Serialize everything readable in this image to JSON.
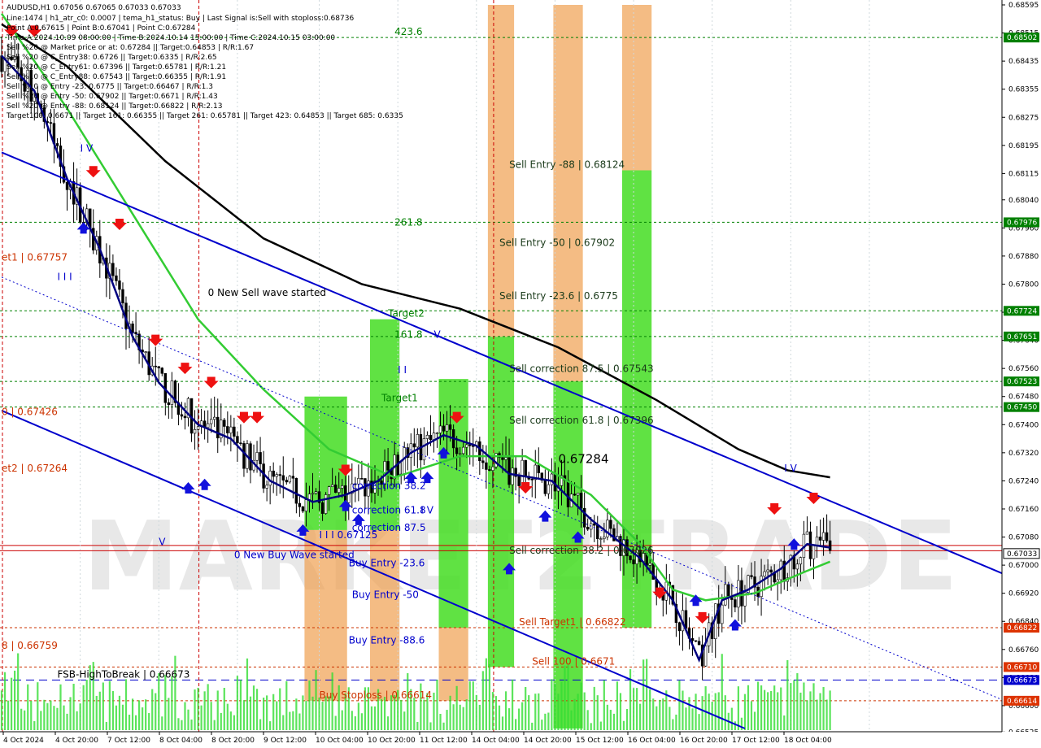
{
  "header": {
    "symbol_line": "AUDUSD,H1  0.67056 0.67065 0.67033 0.67033",
    "info_lines": [
      "Line:1474 | h1_atr_c0: 0.0007 | tema_h1_status: Buy | Last Signal is:Sell with stoploss:0.68736",
      "Point A:0.67615 | Point B:0.67041 | Point C:0.67284",
      "Time A:2024.10.09 08:00:00 | Time B:2024.10.14 15:00:00 | Time C:2024.10.15 03:00:00",
      "Sell %20 @ Market price or at: 0.67284 || Target:0.64853 | R/R:1.67",
      "Sell %20 @ C_Entry38: 0.6726 || Target:0.6335 | R/R:2.65",
      "Sell %20 @ C_Entry61: 0.67396 || Target:0.65781 | R/R:1.21",
      "Sell %10 @ C_Entry88: 0.67543 || Target:0.66355 | R/R:1.91",
      "Sell %10 @ Entry -23: 0.6775 || Target:0.66467 | R/R:1.3",
      "Sell %20 @ Entry -50: 0.67902 || Target:0.6671 | R/R:1.43",
      "Sell %20 @ Entry -88: 0.68124 || Target:0.66822 | R/R:2.13",
      "Target100: 0.6671 || Target 161: 0.66355 || Target 261: 0.65781 || Target 423: 0.64853 || Target 685: 0.6335"
    ]
  },
  "watermark": "MARKET2TRADE",
  "colors": {
    "background": "#ffffff",
    "ema_black": "#000000",
    "tema_navy": "#000080",
    "ema_green": "#33cc33",
    "channel_blue": "#0000cc",
    "level_green": "#008000",
    "level_red": "#cc3300",
    "fsb_blue": "#0000cc",
    "zone_orange": "#f0a050",
    "zone_green": "#44dd22",
    "bar_green": "#33dd33",
    "current_price": "#cc0000"
  },
  "price_axis": {
    "min": 0.66535,
    "max": 0.68595,
    "ticks": [
      "0.68595",
      "0.68515",
      "0.68435",
      "0.68355",
      "0.68275",
      "0.68195",
      "0.68115",
      "0.68040",
      "0.67960",
      "0.67880",
      "0.67800",
      "0.67720",
      "0.67640",
      "0.67560",
      "0.67480",
      "0.67400",
      "0.67320",
      "0.67240",
      "0.67160",
      "0.67080",
      "0.67000",
      "0.66920",
      "0.66840",
      "0.66760",
      "0.66680",
      "0.66600",
      "0.66525"
    ]
  },
  "time_axis": {
    "labels": [
      "4 Oct 2024",
      "4 Oct 20:00",
      "7 Oct 12:00",
      "8 Oct 04:00",
      "8 Oct 20:00",
      "9 Oct 12:00",
      "10 Oct 04:00",
      "10 Oct 20:00",
      "11 Oct 12:00",
      "14 Oct 04:00",
      "14 Oct 20:00",
      "15 Oct 12:00",
      "16 Oct 04:00",
      "16 Oct 20:00",
      "17 Oct 12:00",
      "18 Oct 04:00"
    ]
  },
  "price_tags": [
    {
      "text": "0.68502",
      "value": 0.68502,
      "kind": "green"
    },
    {
      "text": "0.67976",
      "value": 0.67976,
      "kind": "green"
    },
    {
      "text": "0.67724",
      "value": 0.67724,
      "kind": "green"
    },
    {
      "text": "0.67651",
      "value": 0.67651,
      "kind": "green"
    },
    {
      "text": "0.67523",
      "value": 0.67523,
      "kind": "green"
    },
    {
      "text": "0.67450",
      "value": 0.6745,
      "kind": "green"
    },
    {
      "text": "0.67033",
      "value": 0.67033,
      "kind": "black"
    },
    {
      "text": "0.66822",
      "value": 0.66822,
      "kind": "red"
    },
    {
      "text": "0.66710",
      "value": 0.6671,
      "kind": "red"
    },
    {
      "text": "0.66673",
      "value": 0.66673,
      "kind": "blue"
    },
    {
      "text": "0.66614",
      "value": 0.66614,
      "kind": "red"
    }
  ],
  "levels": [
    {
      "value": 0.68502,
      "color": "green"
    },
    {
      "value": 0.67976,
      "color": "green"
    },
    {
      "value": 0.67724,
      "color": "green"
    },
    {
      "value": 0.67651,
      "color": "green"
    },
    {
      "value": 0.67523,
      "color": "green"
    },
    {
      "value": 0.6745,
      "color": "green"
    },
    {
      "value": 0.66822,
      "color": "red"
    },
    {
      "value": 0.6671,
      "color": "red"
    },
    {
      "value": 0.66614,
      "color": "red"
    },
    {
      "value": 0.66673,
      "color": "fsb"
    },
    {
      "value": 0.67041,
      "color": "current"
    },
    {
      "value": 0.67056,
      "color": "current"
    }
  ],
  "chart_labels": [
    {
      "text": "423.6",
      "kind": "fib",
      "x_bar": 120,
      "value": 0.68502
    },
    {
      "text": "261.8",
      "kind": "fib",
      "x_bar": 120,
      "value": 0.6796
    },
    {
      "text": "161.8",
      "kind": "fib",
      "x_bar": 120,
      "value": 0.6764
    },
    {
      "text": "Target2",
      "kind": "fib",
      "x_bar": 118,
      "value": 0.677
    },
    {
      "text": "Target1",
      "kind": "fib",
      "x_bar": 116,
      "value": 0.6746
    },
    {
      "text": "Sell Entry -88 | 0.68124",
      "kind": "dark",
      "x_bar": 155,
      "value": 0.68124
    },
    {
      "text": "Sell Entry -50 | 0.67902",
      "kind": "dark",
      "x_bar": 152,
      "value": 0.67902
    },
    {
      "text": "Sell Entry -23.6 | 0.6775",
      "kind": "dark",
      "x_bar": 152,
      "value": 0.6775
    },
    {
      "text": "Sell correction 87.5 | 0.67543",
      "kind": "dark",
      "x_bar": 155,
      "value": 0.67543
    },
    {
      "text": "Sell correction 61.8 | 0.67396",
      "kind": "dark",
      "x_bar": 155,
      "value": 0.67396
    },
    {
      "text": "Sell correction 38.2 | 0.67026",
      "kind": "dark",
      "x_bar": 155,
      "value": 0.67026
    },
    {
      "text": "0.67284",
      "kind": "big",
      "x_bar": 170,
      "value": 0.67284
    },
    {
      "text": "Sell Target1 | 0.66822",
      "kind": "red",
      "x_bar": 158,
      "value": 0.66822
    },
    {
      "text": "Sell 100 | 0.6671",
      "kind": "red",
      "x_bar": 162,
      "value": 0.6671
    },
    {
      "text": "0 New Sell wave started",
      "kind": "black",
      "x_bar": 63,
      "value": 0.6776
    },
    {
      "text": "0 New Buy Wave started",
      "kind": "navy",
      "x_bar": 71,
      "value": 0.67013
    },
    {
      "text": "correction 38.2",
      "kind": "navy",
      "x_bar": 107,
      "value": 0.6721
    },
    {
      "text": "correction 61.8",
      "kind": "navy",
      "x_bar": 107,
      "value": 0.6714
    },
    {
      "text": "correction 87.5",
      "kind": "navy",
      "x_bar": 107,
      "value": 0.6709
    },
    {
      "text": "Buy Entry -23.6",
      "kind": "navy",
      "x_bar": 106,
      "value": 0.6699
    },
    {
      "text": "Buy Entry -50",
      "kind": "navy",
      "x_bar": 107,
      "value": 0.669
    },
    {
      "text": "Buy Entry -88.6",
      "kind": "navy",
      "x_bar": 106,
      "value": 0.6677
    },
    {
      "text": "Buy Stoploss | 0.66614",
      "kind": "red",
      "x_bar": 97,
      "value": 0.66614
    },
    {
      "text": "FSB-HighToBreak | 0.66673",
      "kind": "black",
      "x_bar": 17,
      "value": 0.66673
    },
    {
      "text": "I I I 0.67125",
      "kind": "navy",
      "x_bar": 97,
      "value": 0.6707
    },
    {
      "text": "et1 | 0.67757",
      "kind": "red",
      "x_bar": 0,
      "value": 0.6786
    },
    {
      "text": "0 | 0.67426",
      "kind": "red",
      "x_bar": 0,
      "value": 0.6742
    },
    {
      "text": "et2 | 0.67264",
      "kind": "red",
      "x_bar": 0,
      "value": 0.6726
    },
    {
      "text": "8 | 0.66759",
      "kind": "red",
      "x_bar": 0,
      "value": 0.66755
    },
    {
      "text": "I V",
      "kind": "navy",
      "x_bar": 24,
      "value": 0.6817
    },
    {
      "text": "I I I",
      "kind": "navy",
      "x_bar": 17,
      "value": 0.67805
    },
    {
      "text": "V",
      "kind": "navy",
      "x_bar": 132,
      "value": 0.6764
    },
    {
      "text": "I I",
      "kind": "navy",
      "x_bar": 121,
      "value": 0.6754
    },
    {
      "text": "I V",
      "kind": "navy",
      "x_bar": 128,
      "value": 0.6714
    },
    {
      "text": "V",
      "kind": "navy",
      "x_bar": 48,
      "value": 0.6705
    },
    {
      "text": "I V",
      "kind": "navy",
      "x_bar": 239,
      "value": 0.6726
    }
  ],
  "chart_data": {
    "type": "candlestick",
    "title": "AUDUSD,H1",
    "last_price": 0.67033,
    "ylim": [
      0.66535,
      0.68595
    ],
    "candles": [],
    "series": [
      {
        "name": "ema_black",
        "values": [
          [
            0,
            0.6854
          ],
          [
            20,
            0.6842
          ],
          [
            50,
            0.6815
          ],
          [
            80,
            0.6793
          ],
          [
            110,
            0.678
          ],
          [
            140,
            0.6773
          ],
          [
            170,
            0.6762
          ],
          [
            200,
            0.6747
          ],
          [
            225,
            0.6733
          ],
          [
            240,
            0.6727
          ],
          [
            253,
            0.6725
          ]
        ]
      },
      {
        "name": "ema_green",
        "values": [
          [
            0,
            0.6857
          ],
          [
            20,
            0.683
          ],
          [
            40,
            0.68
          ],
          [
            60,
            0.677
          ],
          [
            80,
            0.675
          ],
          [
            100,
            0.6733
          ],
          [
            120,
            0.6725
          ],
          [
            140,
            0.6731
          ],
          [
            160,
            0.6731
          ],
          [
            180,
            0.672
          ],
          [
            195,
            0.6706
          ],
          [
            205,
            0.6693
          ],
          [
            215,
            0.669
          ],
          [
            230,
            0.6692
          ],
          [
            245,
            0.6698
          ],
          [
            253,
            0.6701
          ]
        ]
      },
      {
        "name": "tema_navy",
        "values": [
          [
            0,
            0.6845
          ],
          [
            10,
            0.6835
          ],
          [
            20,
            0.681
          ],
          [
            30,
            0.679
          ],
          [
            40,
            0.6765
          ],
          [
            48,
            0.6752
          ],
          [
            60,
            0.674
          ],
          [
            70,
            0.6736
          ],
          [
            82,
            0.6724
          ],
          [
            95,
            0.6718
          ],
          [
            105,
            0.672
          ],
          [
            115,
            0.6724
          ],
          [
            125,
            0.6732
          ],
          [
            135,
            0.6737
          ],
          [
            145,
            0.6734
          ],
          [
            155,
            0.6726
          ],
          [
            168,
            0.6724
          ],
          [
            180,
            0.6713
          ],
          [
            195,
            0.6702
          ],
          [
            205,
            0.669
          ],
          [
            213,
            0.6673
          ],
          [
            220,
            0.669
          ],
          [
            228,
            0.6693
          ],
          [
            238,
            0.6699
          ],
          [
            246,
            0.6706
          ],
          [
            253,
            0.6705
          ]
        ]
      }
    ],
    "channel_lines": [
      {
        "name": "upper",
        "from": [
          0,
          0.68175
        ],
        "to": [
          306,
          0.66975
        ],
        "style": "solid"
      },
      {
        "name": "lower",
        "from": [
          0,
          0.6744
        ],
        "to": [
          227,
          0.66535
        ],
        "style": "solid"
      },
      {
        "name": "middle",
        "from": [
          0,
          0.6782
        ],
        "to": [
          306,
          0.66615
        ],
        "style": "dotted"
      }
    ],
    "zones": [
      {
        "x_bar": [
          93,
          105
        ],
        "from": 0.6748,
        "to": 0.671,
        "color": "green"
      },
      {
        "x_bar": [
          93,
          105
        ],
        "from": 0.671,
        "to": 0.66614,
        "color": "orange"
      },
      {
        "x_bar": [
          113,
          121
        ],
        "from": 0.677,
        "to": 0.671,
        "color": "green"
      },
      {
        "x_bar": [
          113,
          121
        ],
        "from": 0.671,
        "to": 0.66614,
        "color": "orange"
      },
      {
        "x_bar": [
          134,
          142
        ],
        "from": 0.6753,
        "to": 0.66822,
        "color": "green"
      },
      {
        "x_bar": [
          134,
          142
        ],
        "from": 0.66822,
        "to": 0.66614,
        "color": "orange"
      },
      {
        "x_bar": [
          149,
          156
        ],
        "from": 0.68595,
        "to": 0.6765,
        "color": "orange"
      },
      {
        "x_bar": [
          149,
          156
        ],
        "from": 0.6765,
        "to": 0.6671,
        "color": "green"
      },
      {
        "x_bar": [
          169,
          177
        ],
        "from": 0.68595,
        "to": 0.67523,
        "color": "orange"
      },
      {
        "x_bar": [
          169,
          177
        ],
        "from": 0.67523,
        "to": 0.66535,
        "color": "green"
      },
      {
        "x_bar": [
          190,
          198
        ],
        "from": 0.68595,
        "to": 0.68124,
        "color": "orange"
      },
      {
        "x_bar": [
          190,
          198
        ],
        "from": 0.68124,
        "to": 0.66822,
        "color": "green"
      }
    ]
  }
}
